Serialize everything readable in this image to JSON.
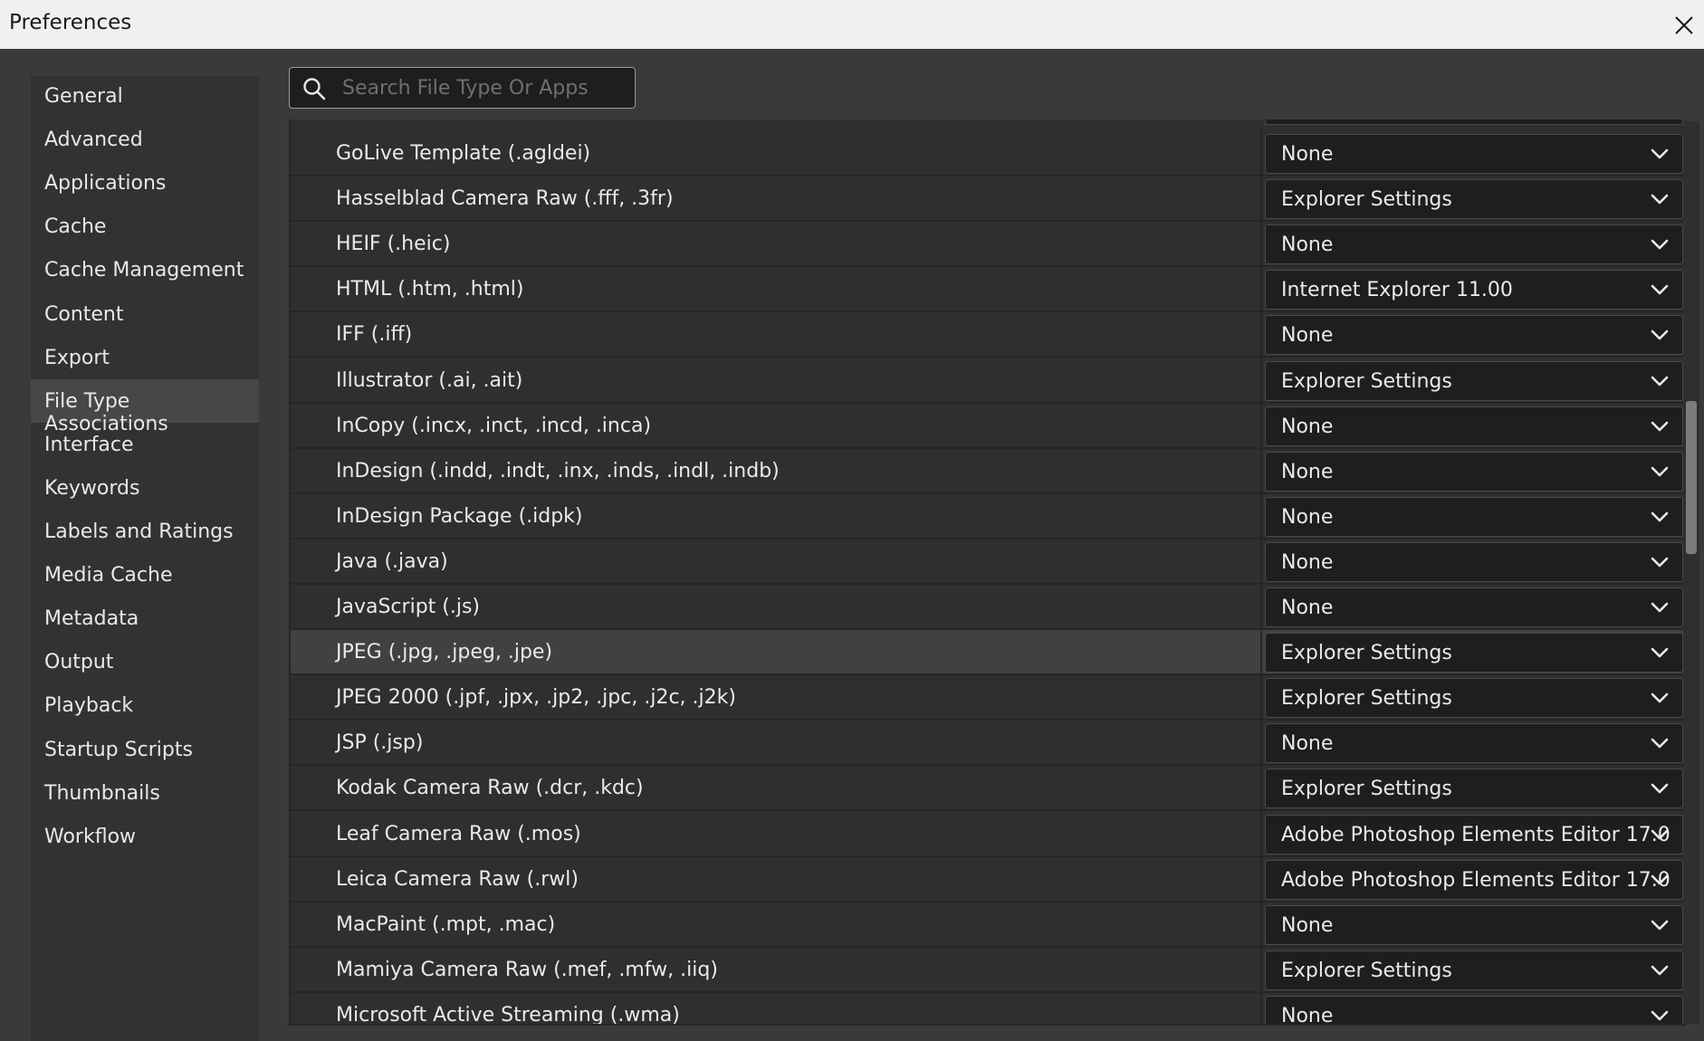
{
  "window": {
    "title": "Preferences",
    "close_icon": "close-icon"
  },
  "sidebar": {
    "selected": "File Type Associations",
    "items": [
      {
        "label": "General"
      },
      {
        "label": "Advanced"
      },
      {
        "label": "Applications"
      },
      {
        "label": "Cache"
      },
      {
        "label": "Cache Management"
      },
      {
        "label": "Content"
      },
      {
        "label": "Export"
      },
      {
        "label": "File Type Associations"
      },
      {
        "label": "Interface"
      },
      {
        "label": "Keywords"
      },
      {
        "label": "Labels and Ratings"
      },
      {
        "label": "Media Cache"
      },
      {
        "label": "Metadata"
      },
      {
        "label": "Output"
      },
      {
        "label": "Playback"
      },
      {
        "label": "Startup Scripts"
      },
      {
        "label": "Thumbnails"
      },
      {
        "label": "Workflow"
      }
    ]
  },
  "search": {
    "placeholder": "Search File Type Or Apps",
    "value": "",
    "icon": "search-icon"
  },
  "file_types": {
    "highlighted_row": "JPEG (.jpg, .jpeg, .jpe)",
    "rows": [
      {
        "name": "GoLive Template (.agldei)",
        "app": "None"
      },
      {
        "name": "Hasselblad Camera Raw (.fff, .3fr)",
        "app": "Explorer Settings"
      },
      {
        "name": "HEIF (.heic)",
        "app": "None"
      },
      {
        "name": "HTML (.htm, .html)",
        "app": "Internet Explorer 11.00"
      },
      {
        "name": "IFF (.iff)",
        "app": "None"
      },
      {
        "name": "Illustrator (.ai, .ait)",
        "app": "Explorer Settings"
      },
      {
        "name": "InCopy (.incx, .inct, .incd, .inca)",
        "app": "None"
      },
      {
        "name": "InDesign (.indd, .indt, .inx, .inds, .indl, .indb)",
        "app": "None"
      },
      {
        "name": "InDesign Package (.idpk)",
        "app": "None"
      },
      {
        "name": "Java (.java)",
        "app": "None"
      },
      {
        "name": "JavaScript (.js)",
        "app": "None"
      },
      {
        "name": "JPEG (.jpg, .jpeg, .jpe)",
        "app": "Explorer Settings"
      },
      {
        "name": "JPEG 2000 (.jpf, .jpx, .jp2, .jpc, .j2c, .j2k)",
        "app": "Explorer Settings"
      },
      {
        "name": "JSP (.jsp)",
        "app": "None"
      },
      {
        "name": "Kodak Camera Raw (.dcr, .kdc)",
        "app": "Explorer Settings"
      },
      {
        "name": "Leaf Camera Raw (.mos)",
        "app": "Adobe Photoshop Elements Editor 17.0"
      },
      {
        "name": "Leica Camera Raw (.rwl)",
        "app": "Adobe Photoshop Elements Editor 17.0"
      },
      {
        "name": "MacPaint (.mpt, .mac)",
        "app": "None"
      },
      {
        "name": "Mamiya Camera Raw (.mef, .mfw, .iiq)",
        "app": "Explorer Settings"
      },
      {
        "name": "Microsoft Active Streaming (.wma)",
        "app": "None"
      }
    ]
  },
  "scrollbar": {
    "position_fraction": 0.31,
    "visible_fraction": 0.17
  },
  "colors": {
    "titlebar": "#f0f0f0",
    "background": "#3a3a3a",
    "sidebar_selected": "#474747",
    "row_highlight": "#414141",
    "dropdown_bg": "#1e1e1e"
  }
}
